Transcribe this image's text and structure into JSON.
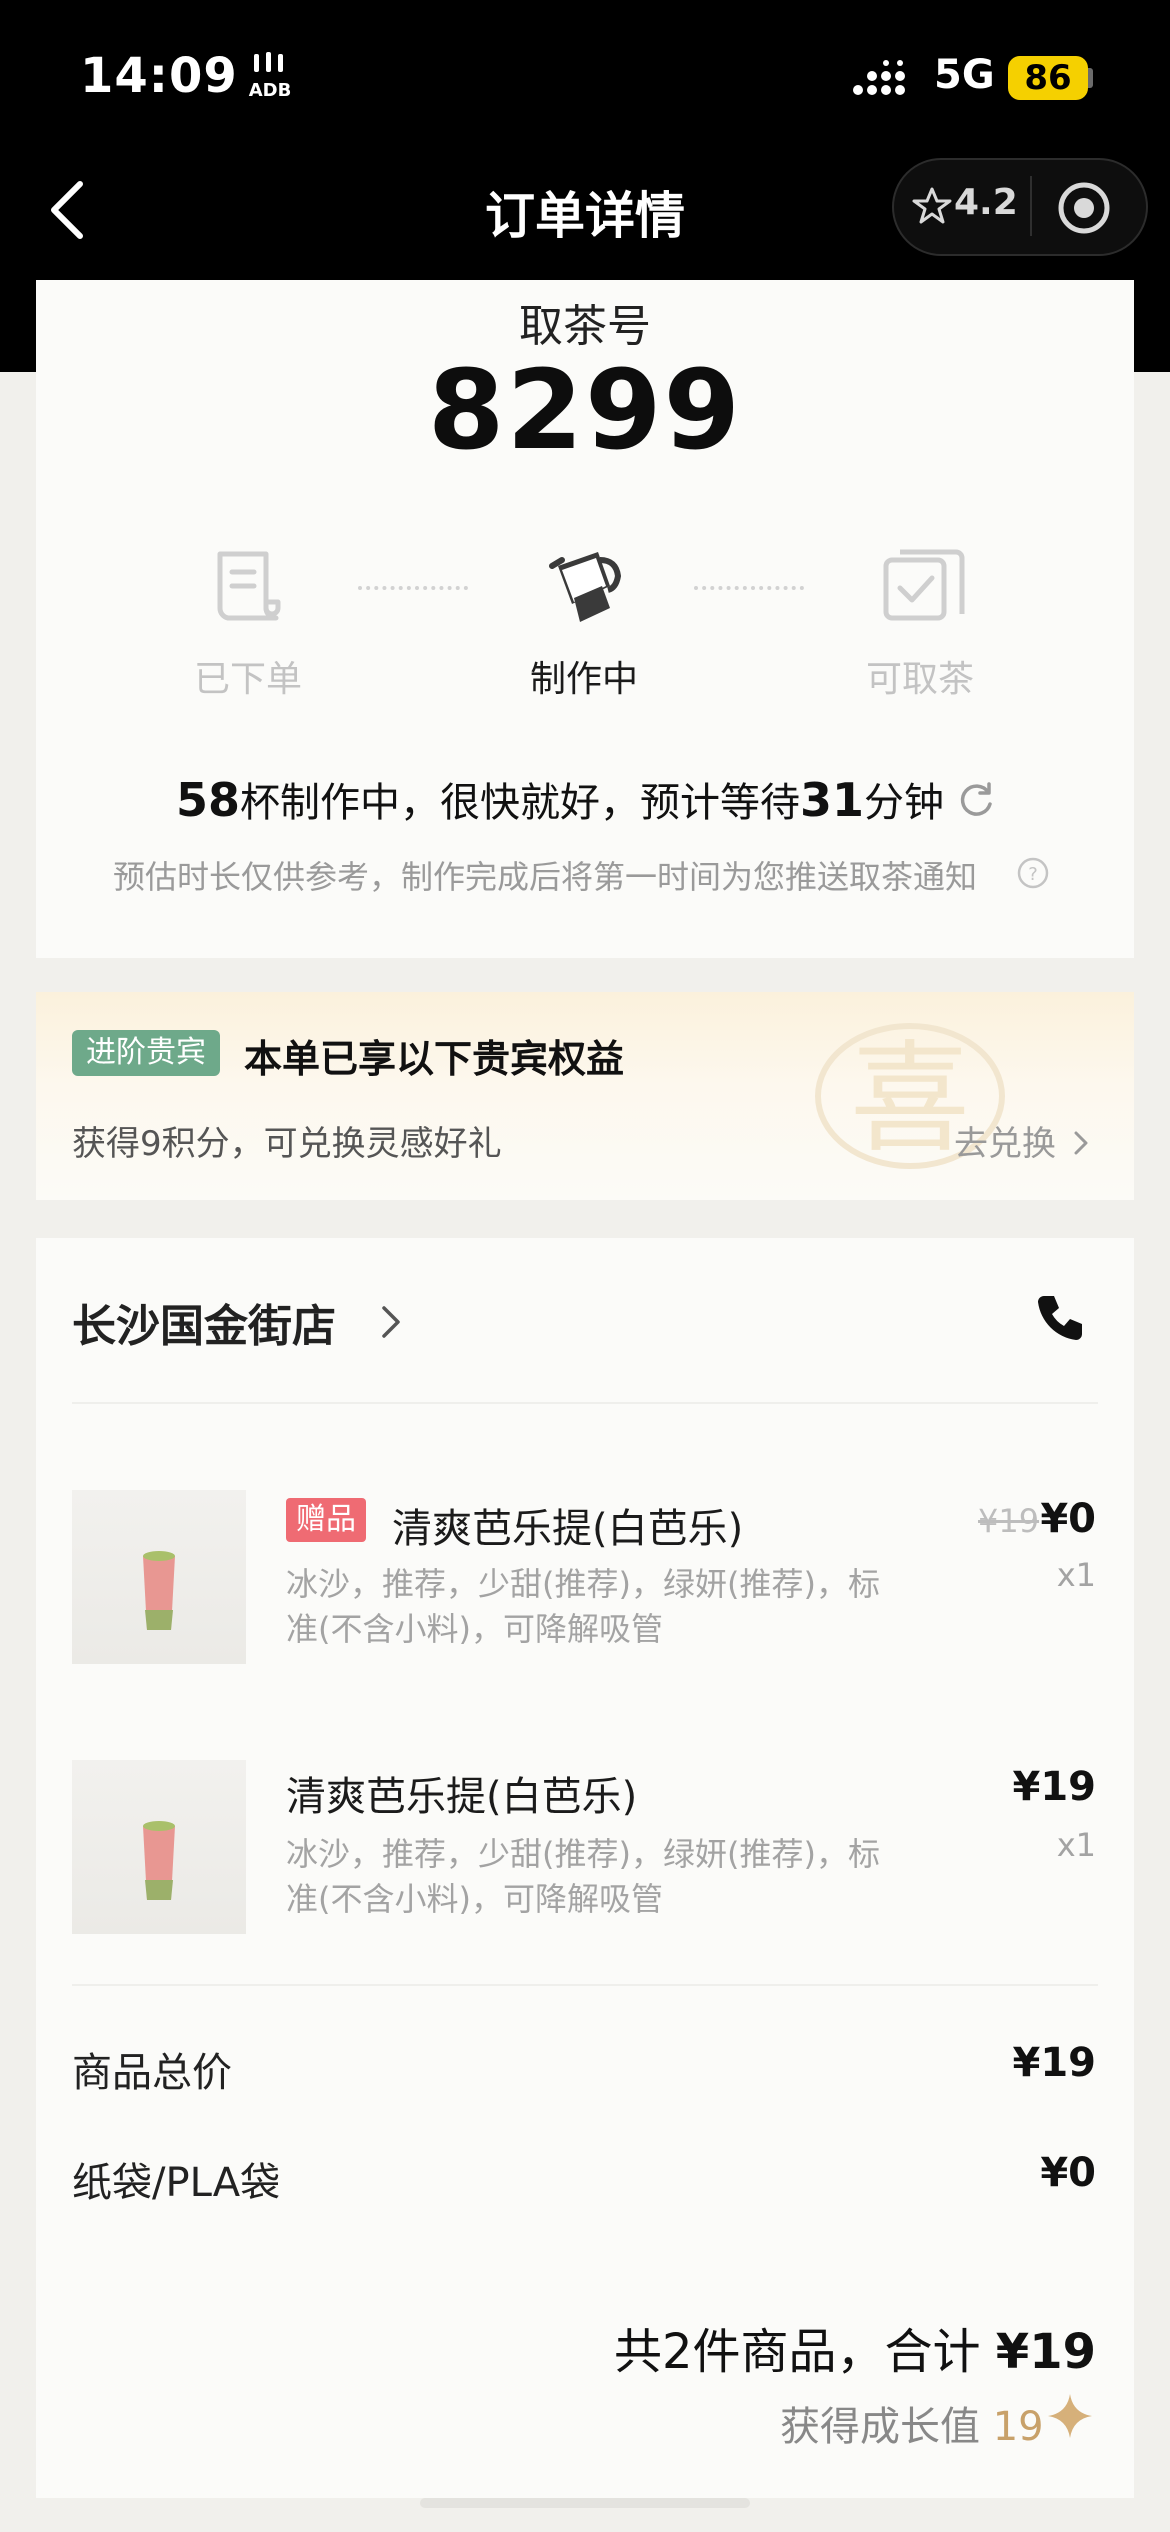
{
  "status_bar": {
    "time": "14:09",
    "network": "5G",
    "battery": "86",
    "rabbit_text": "ADB"
  },
  "nav": {
    "title": "订单详情",
    "rating": "4.2"
  },
  "pickup": {
    "label": "取茶号",
    "number": "8299"
  },
  "steps": [
    {
      "label": "已下单",
      "state": "done"
    },
    {
      "label": "制作中",
      "state": "active"
    },
    {
      "label": "可取茶",
      "state": "pending"
    }
  ],
  "wait": {
    "cups": "58",
    "text1": "杯制作中，很快就好，预计等待",
    "minutes": "31",
    "text2": "分钟",
    "note": "预估时长仅供参考，制作完成后将第一时间为您推送取茶通知"
  },
  "vip": {
    "badge": "进阶贵宾",
    "title": "本单已享以下贵宾权益",
    "subtitle": "获得9积分，可兑换灵感好礼",
    "link": "去兑换",
    "seal_char": "喜"
  },
  "store": {
    "name": "长沙国金街店"
  },
  "items": [
    {
      "tag": "赠品",
      "name": "清爽芭乐提(白芭乐)",
      "desc": "冰沙，推荐，少甜(推荐)，绿妍(推荐)，标准(不含小料)，可降解吸管",
      "old_price": "¥19",
      "price": "¥0",
      "qty": "x1"
    },
    {
      "tag": "",
      "name": "清爽芭乐提(白芭乐)",
      "desc": "冰沙，推荐，少甜(推荐)，绿妍(推荐)，标准(不含小料)，可降解吸管",
      "old_price": "",
      "price": "¥19",
      "qty": "x1"
    }
  ],
  "summary": {
    "goods_label": "商品总价",
    "goods_value": "¥19",
    "bag_label": "纸袋/PLA袋",
    "bag_value": "¥0",
    "total_prefix": "共2件商品，合计",
    "total_value": "¥19",
    "growth_label": "获得成长值",
    "growth_value": "19"
  },
  "colors": {
    "accent_gift": "#ef6b73",
    "vip_green": "#6ea98a",
    "gold": "#c8a16a"
  }
}
